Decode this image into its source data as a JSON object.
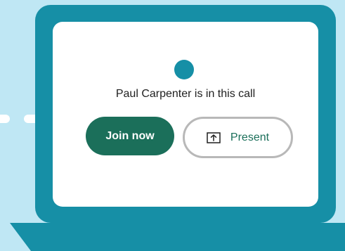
{
  "call": {
    "status_text": "Paul Carpenter is in this call"
  },
  "actions": {
    "join_label": "Join now",
    "present_label": "Present",
    "present_icon": "present-upload-icon"
  },
  "colors": {
    "background": "#bfe7f4",
    "device": "#168fa6",
    "accent": "#1b6f5a",
    "outline": "#b8b8b8"
  }
}
